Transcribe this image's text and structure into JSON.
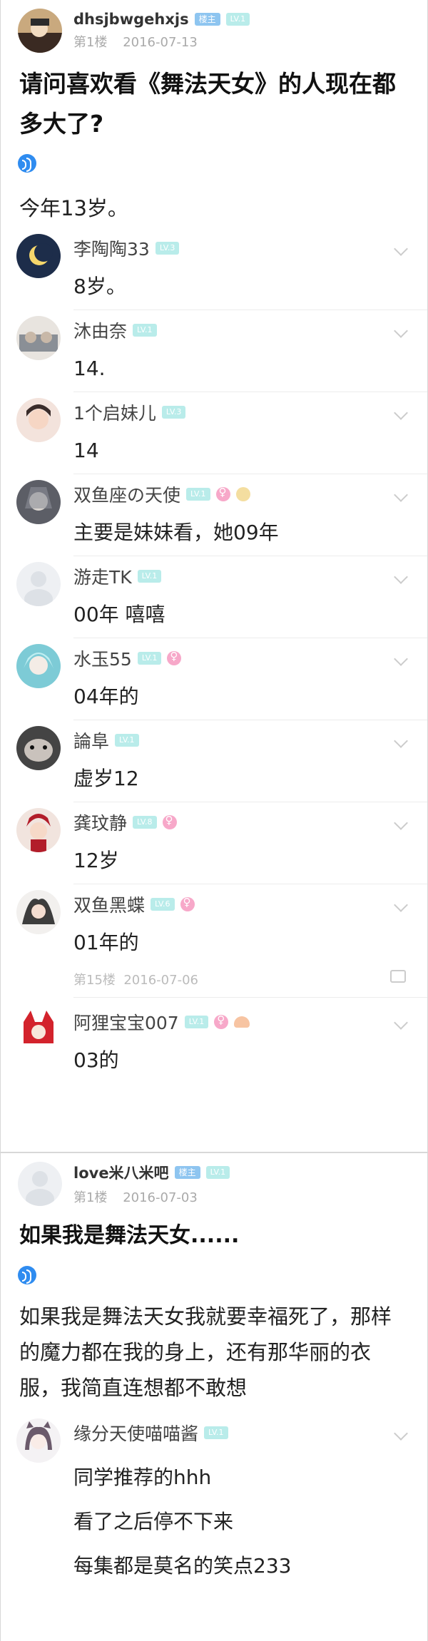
{
  "post1": {
    "author": "dhsjbwgehxjs",
    "host_badge": "楼主",
    "level_badge": "LV.1",
    "floor": "第1楼",
    "date": "2016-07-13",
    "title": "请问喜欢看《舞法天女》的人现在都多大了?",
    "body": "今年13岁。",
    "replies": [
      {
        "name": "李陶陶33",
        "lv": "LV.3",
        "text": "8岁。"
      },
      {
        "name": "沐由奈",
        "lv": "LV.1",
        "text": "14."
      },
      {
        "name": "1个启妹儿",
        "lv": "LV.3",
        "text": "14"
      },
      {
        "name": "双鱼座の天使",
        "lv": "LV.1",
        "text": "主要是妹妹看，她09年"
      },
      {
        "name": "游走TK",
        "lv": "LV.1",
        "text": "00年 嘻嘻"
      },
      {
        "name": "水玉55",
        "lv": "LV.1",
        "text": "04年的"
      },
      {
        "name": "論阜",
        "lv": "LV.1",
        "text": "虚岁12"
      },
      {
        "name": "龚玟静",
        "lv": "LV.8",
        "text": "12岁"
      },
      {
        "name": "双鱼黑蝶",
        "lv": "LV.6",
        "text": "01年的",
        "floor": "第15楼",
        "date": "2016-07-06"
      },
      {
        "name": "阿狸宝宝007",
        "lv": "LV.1",
        "text": "03的"
      }
    ]
  },
  "post2": {
    "author": "love米八米吧",
    "host_badge": "楼主",
    "level_badge": "LV.1",
    "floor": "第1楼",
    "date": "2016-07-03",
    "title": "如果我是舞法天女......",
    "body": "如果我是舞法天女我就要幸福死了，那样的魔力都在我的身上，还有那华丽的衣服，我简直连想都不敢想",
    "reply": {
      "name": "缘分天使喵喵酱",
      "lv": "LV.1",
      "lines": [
        "同学推荐的hhh",
        "看了之后停不下来",
        "每集都是莫名的笑点233"
      ]
    }
  },
  "colors": {
    "accent_blue": "#2f8cf0",
    "level_badge": "#b9ecea",
    "host_badge": "#8ec5f0",
    "female": "#f7a8c9"
  }
}
